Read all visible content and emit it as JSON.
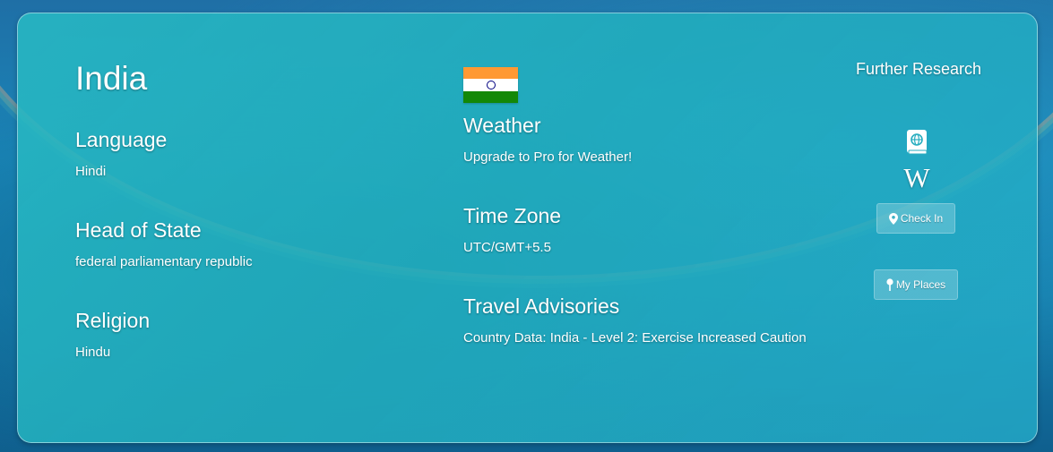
{
  "country": {
    "name": "India"
  },
  "left": [
    {
      "title": "Language",
      "value": "Hindi"
    },
    {
      "title": "Head of State",
      "value": "federal parliamentary republic"
    },
    {
      "title": "Religion",
      "value": "Hindu"
    }
  ],
  "middle": [
    {
      "title": "Weather",
      "value": "Upgrade to Pro for Weather!"
    },
    {
      "title": "Time Zone",
      "value": "UTC/GMT+5.5"
    },
    {
      "title": "Travel Advisories",
      "value": "Country Data: India - Level 2: Exercise Increased Caution"
    }
  ],
  "flag": {
    "icon": "india-flag",
    "colors": [
      "#ff9933",
      "#ffffff",
      "#138808"
    ],
    "chakra_color": "#000080"
  },
  "research": {
    "heading": "Further Research",
    "guide_icon": "globe-book-icon",
    "wiki_glyph": "W",
    "checkin_label": "Check In",
    "checkin_icon": "map-pin-icon",
    "places_label": "My Places",
    "places_icon": "pushpin-icon"
  },
  "theme": {
    "card": "#28b9c3",
    "text": "#ffffff"
  }
}
